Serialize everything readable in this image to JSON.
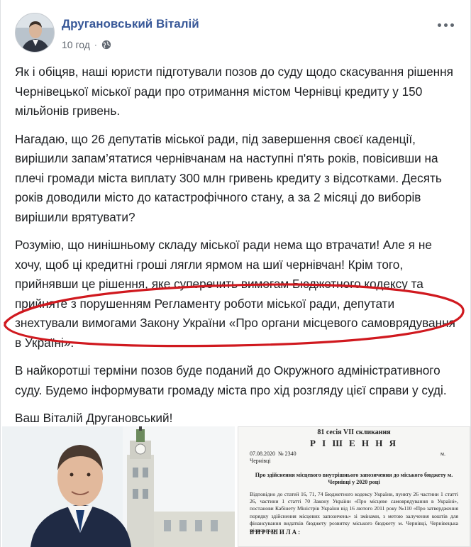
{
  "post": {
    "author": "Другановський Віталій",
    "time": "10 год",
    "separator": "·",
    "icons": {
      "avatar": "avatar-photo",
      "privacy": "globe-icon",
      "menu": "more-options-icon"
    },
    "paragraphs": [
      "Як і обіцяв, наші юристи підготували позов до суду щодо скасування рішення Чернівецької міської ради про отримання містом Чернівці кредиту у 150 мільйонів гривень.",
      "Нагадаю, що 26 депутатів міської ради, під завершення своєї каденції, вирішили запам’ятатися чернівчанам на наступні п'ять років, повісивши на плечі громади міста виплату 300 млн гривень кредиту з відсотками. Десять років доводили місто до катастрофічного стану, а за 2 місяці до виборів вирішили врятувати?",
      "Розумію, що нинішньому складу міської ради нема що втрачати! Але я не хочу, щоб ці кредитні гроші лягли ярмом на шиї чернівчан! Крім того, прийнявши це рішення, яке суперечить вимогам Бюджетного кодексу та прийняте з порушенням Регламенту роботи міської ради, депутати знехтували вимогами Закону України «Про органи місцевого самоврядування в Україні».",
      "В найкоротші терміни позов буде поданий до Окружного адміністративного суду. Будемо інформувати громаду міста про хід розгляду цієї справи у суді.",
      "Ваш Віталій Другановський!"
    ],
    "highlight_color": "#d0191f",
    "link_color": "#385898"
  },
  "document": {
    "session": "81 сесія VII скликання",
    "title": "Р І Ш Е Н Н Я",
    "date": "07.08.2020",
    "number": "№ 2340",
    "m": "м.",
    "city": "Чернівці",
    "subject": "Про здійснення місцевого внутрішнього запозичення до міського бюджету м. Чернівці у 2020 році",
    "body": "Відповідно до статей 16, 71, 74 Бюджетного кодексу України, пункту 26 частини 1 статті 26, частини 1 статті 70 Закону України «Про місцеве самоврядування в Україні», постанови Кабінету Міністрів України від 16 лютого 2011 року №110 «Про затвердження порядку здійснення місцевих запозичень» зі змінами, з метою залучення коштів для фінансування видатків бюджету розвитку міського бюджету м. Чернівці, Чернівецька міська рада",
    "resolve": "ВИРІШИЛА:",
    "resolve2": "ВИРІШИЛА:"
  }
}
